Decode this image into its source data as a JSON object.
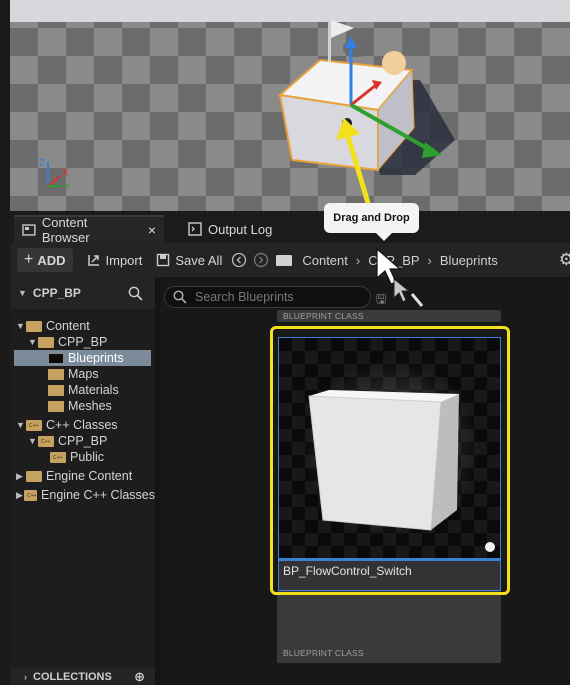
{
  "viewport": {
    "axis_labels": {
      "z": "Z",
      "x": "X",
      "y": "Y"
    }
  },
  "tooltip": {
    "text": "Drag and Drop"
  },
  "tabs": [
    {
      "label": "Content Browser",
      "close": "×"
    },
    {
      "label": "Output Log"
    }
  ],
  "toolbar": {
    "add_label": "ADD",
    "import_label": "Import",
    "save_all_label": "Save All",
    "breadcrumb": [
      "Content",
      "CPP_BP",
      "Blueprints"
    ]
  },
  "tree": {
    "header": "CPP_BP",
    "items": [
      {
        "label": "Content"
      },
      {
        "label": "CPP_BP"
      },
      {
        "label": "Blueprints"
      },
      {
        "label": "Maps"
      },
      {
        "label": "Materials"
      },
      {
        "label": "Meshes"
      },
      {
        "label": "C++ Classes"
      },
      {
        "label": "CPP_BP"
      },
      {
        "label": "Public"
      },
      {
        "label": "Engine Content"
      },
      {
        "label": "Engine C++ Classes"
      }
    ],
    "collections_label": "COLLECTIONS"
  },
  "assets": {
    "search_placeholder": "Search Blueprints",
    "card_type_label": "BLUEPRINT CLASS",
    "asset_name": "BP_FlowControl_Switch"
  },
  "colors": {
    "highlight": "#f2e11a",
    "selection": "#3b7fd6",
    "folder": "#c6a262"
  }
}
